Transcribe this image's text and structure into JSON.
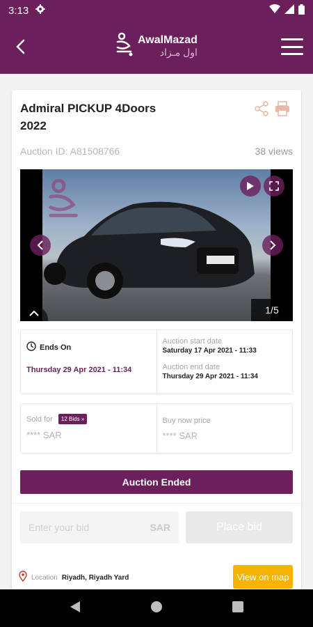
{
  "status_bar": {
    "time": "3:13"
  },
  "app_bar": {
    "logo_en": "AwalMazad",
    "logo_ar": "اول مـزاد"
  },
  "listing": {
    "title": "Admiral PICKUP 4Doors 2022",
    "auction_id": "Auction ID: A81508766",
    "views": "38 views"
  },
  "gallery": {
    "counter": "1/5"
  },
  "timing": {
    "ends_on_label": "Ends On",
    "ends_on_value": "Thursday 29 Apr 2021 - 11:34",
    "start_label": "Auction start date",
    "start_value": "Saturday 17 Apr 2021 - 11:33",
    "end_label": "Auction end date",
    "end_value": "Thursday 29 Apr 2021 - 11:34"
  },
  "pricing": {
    "sold_for_label": "Sold for",
    "bids_badge": "12 Bids »",
    "sold_for_value": "**** SAR",
    "buy_now_label": "Buy now price",
    "buy_now_value": "**** SAR"
  },
  "status_banner": "Auction Ended",
  "bid_form": {
    "placeholder": "Enter your bid",
    "currency": "SAR",
    "button": "Place bid"
  },
  "location": {
    "label": "Location",
    "value": "Riyadh, Riyadh Yard",
    "map_button": "View on map"
  },
  "colors": {
    "brand": "#6b1f5b",
    "accent": "#f6b400"
  }
}
